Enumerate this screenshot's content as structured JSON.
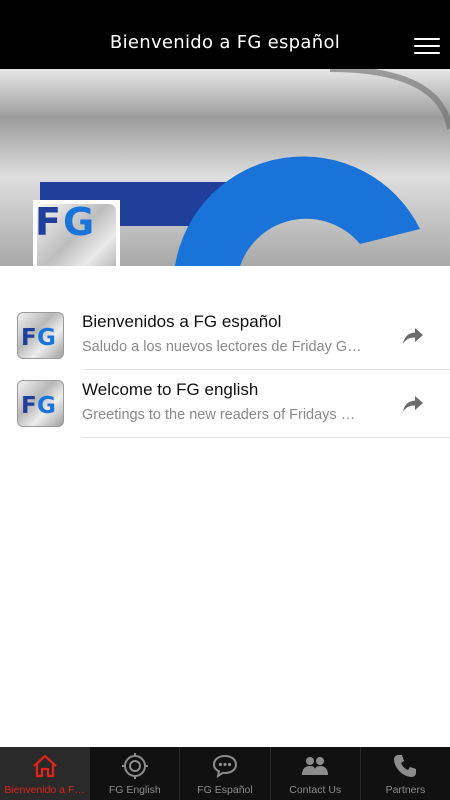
{
  "header": {
    "title": "Bienvenido a FG español",
    "menu_icon": "hamburger-menu-icon"
  },
  "banner": {
    "logo_text": "FG",
    "colors": {
      "blue": "#1a73d9",
      "navy": "#1f3f9a",
      "metal": "#b5b5b5"
    }
  },
  "list": {
    "items": [
      {
        "title": "Bienvenidos a FG español",
        "subtitle": "Saludo a los nuevos lectores de Friday G…",
        "icon_text": "FG",
        "action_icon": "share-arrow-icon"
      },
      {
        "title": "Welcome to FG english",
        "subtitle": "Greetings to the new readers of Fridays …",
        "icon_text": "FG",
        "action_icon": "share-arrow-icon"
      }
    ]
  },
  "tabs": [
    {
      "label": "Bienvenido a F…",
      "icon": "home-icon",
      "active": true
    },
    {
      "label": "FG English",
      "icon": "globe-icon",
      "active": false
    },
    {
      "label": "FG Español",
      "icon": "chat-bubble-icon",
      "active": false
    },
    {
      "label": "Contact Us",
      "icon": "people-icon",
      "active": false
    },
    {
      "label": "Partners",
      "icon": "phone-icon",
      "active": false
    }
  ],
  "colors": {
    "header_bg": "#000000",
    "tabbar_bg": "#111111",
    "active_tab": "#e0241b",
    "inactive_tab": "#8c8c8c",
    "fg_blue": "#1a73d9",
    "fg_navy": "#1f3f9a"
  }
}
